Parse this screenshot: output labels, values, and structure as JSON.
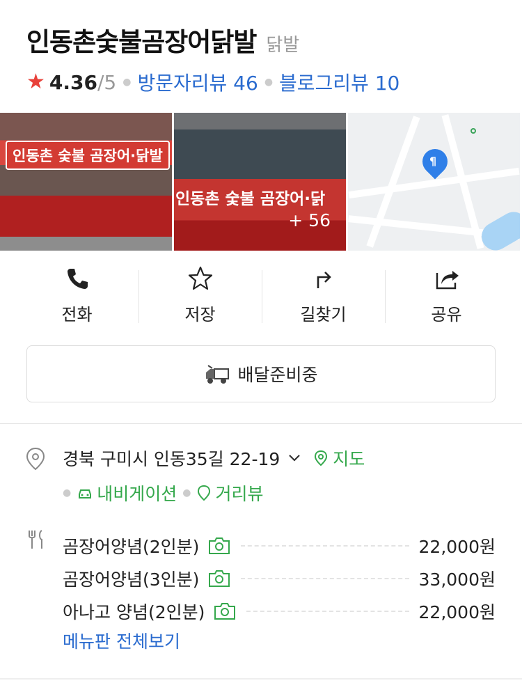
{
  "place": {
    "name": "인동촌숯불곰장어닭발",
    "category": "닭발",
    "rating": "4.36",
    "rating_max": "/5",
    "visitor_reviews": "방문자리뷰 46",
    "blog_reviews": "블로그리뷰 10"
  },
  "photos": {
    "sign1": "인동촌 숯불 곰장어·닭발",
    "sign2": "인동촌 숯불 곰장어·닭",
    "more_count": "+ 56"
  },
  "actions": [
    {
      "label": "전화",
      "icon": "phone-icon"
    },
    {
      "label": "저장",
      "icon": "star-outline-icon"
    },
    {
      "label": "길찾기",
      "icon": "directions-icon"
    },
    {
      "label": "공유",
      "icon": "share-icon"
    }
  ],
  "delivery": {
    "label": "배달준비중",
    "icon": "delivery-truck-icon"
  },
  "address": {
    "text": "경북 구미시 인동35길 22-19",
    "map_link": "지도",
    "navigation_link": "내비게이션",
    "streetview_link": "거리뷰"
  },
  "menu": {
    "items": [
      {
        "name": "곰장어양념(2인분)",
        "price": "22,000원"
      },
      {
        "name": "곰장어양념(3인분)",
        "price": "33,000원"
      },
      {
        "name": "아나고 양념(2인분)",
        "price": "22,000원"
      }
    ],
    "view_all": "메뉴판 전체보기"
  },
  "colors": {
    "accent_blue": "#2a6bcf",
    "green": "#35a84c",
    "star_red": "#e8413a"
  }
}
